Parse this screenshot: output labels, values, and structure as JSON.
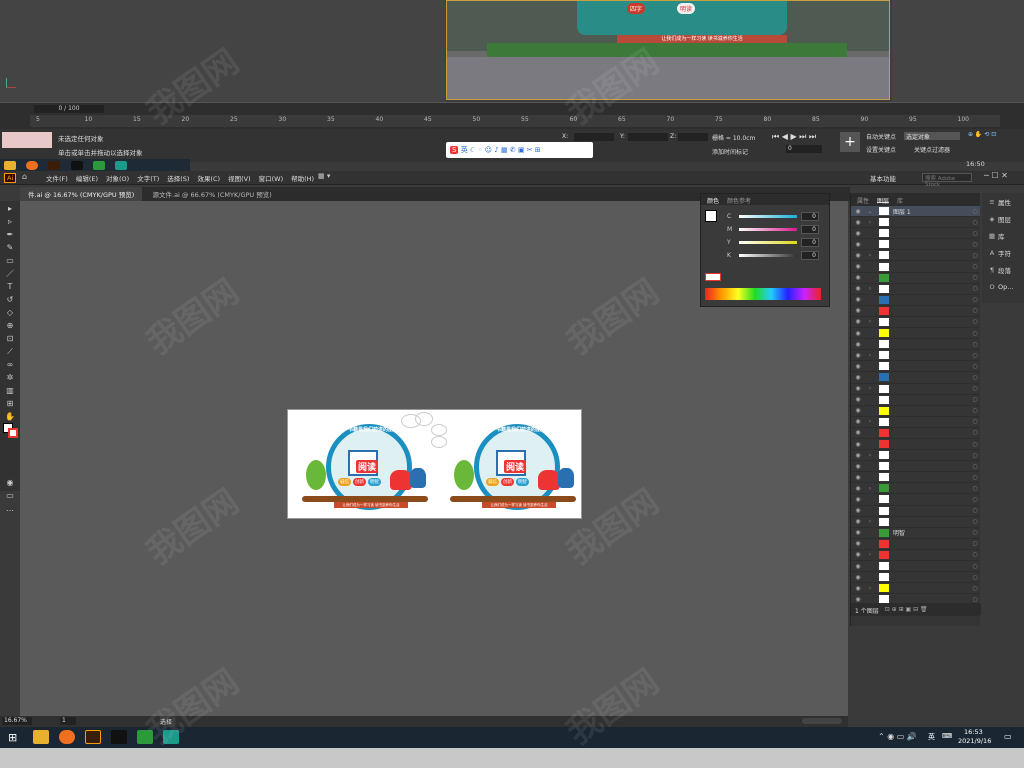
{
  "max": {
    "timeline_counter": "0 / 100",
    "ruler_ticks": [
      "5",
      "10",
      "15",
      "20",
      "25",
      "30",
      "35",
      "40",
      "45",
      "50",
      "55",
      "60",
      "65",
      "70",
      "75",
      "80",
      "85",
      "90",
      "95",
      "100"
    ],
    "status_line1": "未选定任何对象",
    "status_line2": "单击或单击并拖动以选择对象",
    "grid_label": "栅格 = 10.0cm",
    "add_time_tag": "添加时间标记",
    "auto_key": "自动关键点",
    "selected_object": "选定对象",
    "set_key": "设置关键点",
    "key_filter": "关键点过滤器",
    "frame_value": "0",
    "coord_x": "X:",
    "coord_y": "Y:",
    "coord_z": "Z:",
    "ime": "英",
    "time_top": "16:50",
    "scene_banner": "让我们成为一样习读  读书滋养你生活",
    "scene_sign_1": "四字",
    "scene_sign_2": "明读"
  },
  "ai": {
    "logo": "Ai",
    "menus": [
      "文件(F)",
      "编辑(E)",
      "对象(O)",
      "文字(T)",
      "选择(S)",
      "效果(C)",
      "视图(V)",
      "窗口(W)",
      "帮助(H)"
    ],
    "workspace": "基本功能",
    "search_placeholder": "搜索 Adobe Stock",
    "tabs": [
      "件.ai @ 16.67% (CMYK/GPU 预览)",
      "源文件.ai @ 66.67% (CMYK/GPU 预览)"
    ],
    "zoom": "16.67%",
    "page": "1",
    "status_tool": "选择",
    "color_panel": {
      "tab_color": "颜色",
      "tab_guide": "颜色参考",
      "rows": [
        {
          "label": "C",
          "value": "0",
          "color": "#19b0d8"
        },
        {
          "label": "M",
          "value": "0",
          "color": "#d8198c"
        },
        {
          "label": "Y",
          "value": "0",
          "color": "#e0d81c"
        },
        {
          "label": "K",
          "value": "0",
          "color": "#333333"
        }
      ]
    },
    "layers_panel": {
      "tab_props": "属性",
      "tab_layers": "图层",
      "tab_lib": "库",
      "layer_top": "图层 1",
      "named_item": "明智",
      "footer": "1 个图层"
    },
    "dock": [
      {
        "icon": "≡",
        "label": "属性"
      },
      {
        "icon": "◈",
        "label": "图层"
      },
      {
        "icon": "▦",
        "label": "库"
      },
      {
        "icon": "A",
        "label": "字符"
      },
      {
        "icon": "¶",
        "label": "段落"
      },
      {
        "icon": "O",
        "label": "Op..."
      }
    ],
    "artboard": {
      "title": "阅读",
      "arc_text": "书籍是我们前进的朋友",
      "banner": "让我们成为一样习读  读书滋养你生活",
      "tags": [
        "诚信",
        "创新",
        "明智"
      ]
    }
  },
  "taskbar": {
    "time": "16:53",
    "date": "2021/9/16",
    "ime": "英"
  },
  "watermark": "我图网"
}
